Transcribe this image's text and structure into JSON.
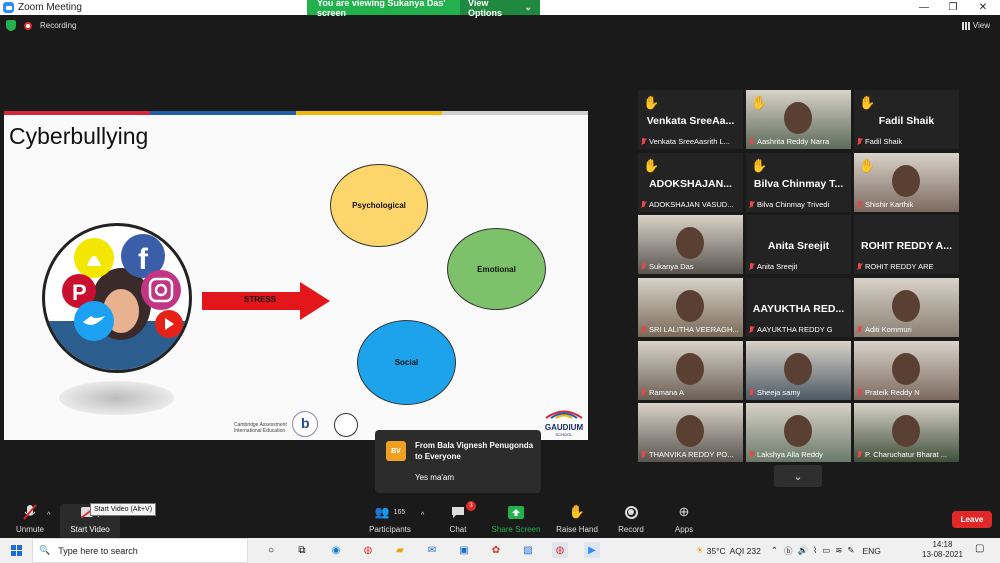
{
  "window": {
    "title": "Zoom Meeting",
    "share_banner": "You are viewing Sukanya Das' screen",
    "view_options": "View Options",
    "recording": "Recording",
    "view_label": "View"
  },
  "slide": {
    "title": "Cyberbullying",
    "arrow_label": "STRESS",
    "bubbles": [
      "Psychological",
      "Emotional",
      "Social"
    ],
    "footer_left": "Cambridge Assessment International Education",
    "footer_brand": "GAUDIUM",
    "footer_brand_sub": "SCHOOL",
    "colors": {
      "psychological": "#fdd66b",
      "emotional": "#7dc26a",
      "social": "#1ca3ec",
      "arrow": "#e3161b"
    }
  },
  "participants": [
    {
      "big": "Venkata SreeAa...",
      "label": "Venkata SreeAasrith L...",
      "hand": true
    },
    {
      "big": "",
      "label": "Aashrita Reddy Narra",
      "hand": true,
      "video": true
    },
    {
      "big": "Fadil Shaik",
      "label": "Fadil Shaik",
      "hand": true
    },
    {
      "big": "ADOKSHAJAN...",
      "label": "ADOKSHAJAN VASUD...",
      "hand": true
    },
    {
      "big": "Bilva Chinmay T...",
      "label": "Bilva Chinmay Trivedi",
      "hand": true
    },
    {
      "big": "",
      "label": "Shishir Karthik",
      "hand": true,
      "video": true
    },
    {
      "big": "",
      "label": "Sukanya Das",
      "hand": false,
      "video": true,
      "active": true
    },
    {
      "big": "Anita Sreejit",
      "label": "Anita Sreejit",
      "hand": false
    },
    {
      "big": "ROHIT REDDY A...",
      "label": "ROHIT REDDY ARE",
      "hand": false
    },
    {
      "big": "",
      "label": "SRI LALITHA VEERAGH...",
      "hand": false,
      "video": true
    },
    {
      "big": "AAYUKTHA RED...",
      "label": "AAYUKTHA REDDY G",
      "hand": false
    },
    {
      "big": "",
      "label": "Aditi Kommuri",
      "hand": false,
      "video": true
    },
    {
      "big": "",
      "label": "Ramana A",
      "hand": false,
      "video": true
    },
    {
      "big": "",
      "label": "Sheeja samy",
      "hand": false,
      "video": true
    },
    {
      "big": "",
      "label": "Prateik Reddy N",
      "hand": false,
      "video": true
    },
    {
      "big": "",
      "label": "THANVIKA REDDY PO...",
      "hand": false,
      "video": true
    },
    {
      "big": "",
      "label": "Lakshya Alla Reddy",
      "hand": false,
      "video": true
    },
    {
      "big": "",
      "label": "P. Charuchatur Bharat ...",
      "hand": false,
      "video": true
    }
  ],
  "chat_popup": {
    "avatar": "BV",
    "from": "From Bala Vignesh Penugonda to Everyone",
    "message": "Yes ma'am"
  },
  "tooltip": "Start Video (Alt+V)",
  "toolbar": {
    "unmute": "Unmute",
    "start_video": "Start Video",
    "participants": "Participants",
    "participants_count": "165",
    "chat": "Chat",
    "chat_badge": "3",
    "share_screen": "Share Screen",
    "raise_hand": "Raise Hand",
    "record": "Record",
    "apps": "Apps",
    "leave": "Leave"
  },
  "taskbar": {
    "search_placeholder": "Type here to search",
    "weather": "35°C",
    "aqi": "AQI 232",
    "language": "ENG",
    "time": "14:18",
    "date": "13-08-2021"
  }
}
